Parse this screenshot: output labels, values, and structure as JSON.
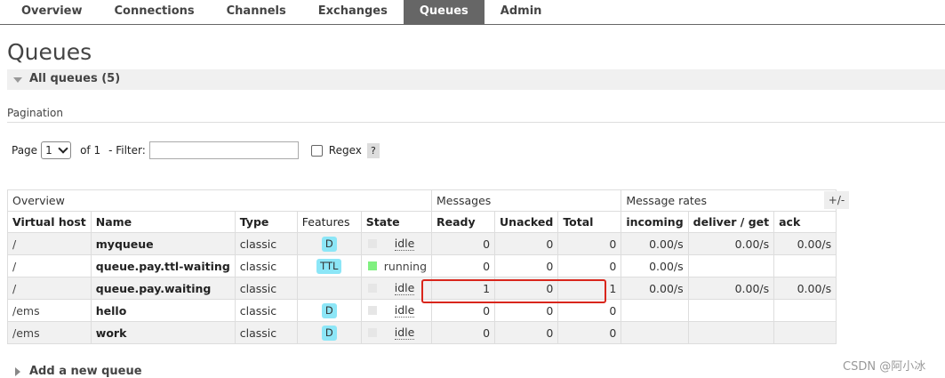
{
  "nav": {
    "tabs": [
      "Overview",
      "Connections",
      "Channels",
      "Exchanges",
      "Queues",
      "Admin"
    ],
    "active": "Queues"
  },
  "page": {
    "title": "Queues",
    "section_title": "All queues (5)",
    "pagination_label": "Pagination",
    "page_label": "Page",
    "page_value": "1",
    "of_label": "of 1",
    "filter_label": "- Filter:",
    "filter_value": "",
    "regex_label": "Regex",
    "help_label": "?",
    "plus_minus": "+/-",
    "add_queue": "Add a new queue",
    "watermark": "CSDN @阿小冰"
  },
  "table": {
    "groups": {
      "overview": "Overview",
      "messages": "Messages",
      "rates": "Message rates"
    },
    "columns": [
      "Virtual host",
      "Name",
      "Type",
      "Features",
      "State",
      "Ready",
      "Unacked",
      "Total",
      "incoming",
      "deliver / get",
      "ack"
    ],
    "rows": [
      {
        "vhost": "/",
        "name": "myqueue",
        "type": "classic",
        "feature": "D",
        "state": "idle",
        "ready": "0",
        "unacked": "0",
        "total": "0",
        "incoming": "0.00/s",
        "deliver": "0.00/s",
        "ack": "0.00/s"
      },
      {
        "vhost": "/",
        "name": "queue.pay.ttl-waiting",
        "type": "classic",
        "feature": "TTL",
        "state": "running",
        "ready": "0",
        "unacked": "0",
        "total": "0",
        "incoming": "0.00/s",
        "deliver": "",
        "ack": ""
      },
      {
        "vhost": "/",
        "name": "queue.pay.waiting",
        "type": "classic",
        "feature": "",
        "state": "idle",
        "ready": "1",
        "unacked": "0",
        "total": "1",
        "incoming": "0.00/s",
        "deliver": "0.00/s",
        "ack": "0.00/s"
      },
      {
        "vhost": "/ems",
        "name": "hello",
        "type": "classic",
        "feature": "D",
        "state": "idle",
        "ready": "0",
        "unacked": "0",
        "total": "0",
        "incoming": "",
        "deliver": "",
        "ack": ""
      },
      {
        "vhost": "/ems",
        "name": "work",
        "type": "classic",
        "feature": "D",
        "state": "idle",
        "ready": "0",
        "unacked": "0",
        "total": "0",
        "incoming": "",
        "deliver": "",
        "ack": ""
      }
    ]
  },
  "colors": {
    "active_tab": "#666666",
    "feature_badge": "#8ce6f7",
    "running": "#80f080",
    "highlight": "#d9261c"
  }
}
